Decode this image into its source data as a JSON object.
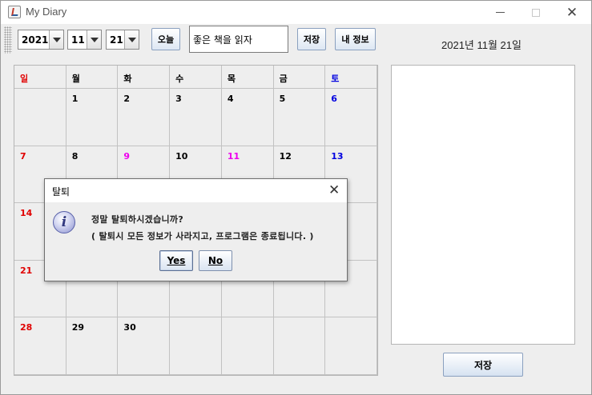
{
  "window": {
    "title": "My Diary"
  },
  "toolbar": {
    "year": "2021",
    "month": "11",
    "day": "21",
    "today_label": "오늘",
    "memo_value": "좋은 책을 읽자",
    "save_label": "저장",
    "myinfo_label": "내 정보"
  },
  "date_label": "2021년 11월 21일",
  "calendar": {
    "weekdays": [
      "일",
      "월",
      "화",
      "수",
      "목",
      "금",
      "토"
    ],
    "weeks": [
      [
        "",
        "1",
        "2",
        "3",
        "4",
        "5",
        "6"
      ],
      [
        "7",
        "8",
        "9",
        "10",
        "11",
        "12",
        "13"
      ],
      [
        "14",
        "",
        "",
        "",
        "",
        "",
        ""
      ],
      [
        "21",
        "",
        "",
        "",
        "",
        "",
        ""
      ],
      [
        "28",
        "29",
        "30",
        "",
        "",
        "",
        ""
      ]
    ]
  },
  "colors": {
    "sunday": "#e00000",
    "saturday": "#0000e0",
    "holiday": "#ee00ee"
  },
  "save_button": "저장",
  "dialog": {
    "title": "탈퇴",
    "message_line1": "정말 탈퇴하시겠습니까?",
    "message_line2": "( 탈퇴시 모든 정보가 사라지고, 프로그램은 종료됩니다. )",
    "yes_label": "Yes",
    "no_label": "No",
    "icon": "info-icon"
  }
}
